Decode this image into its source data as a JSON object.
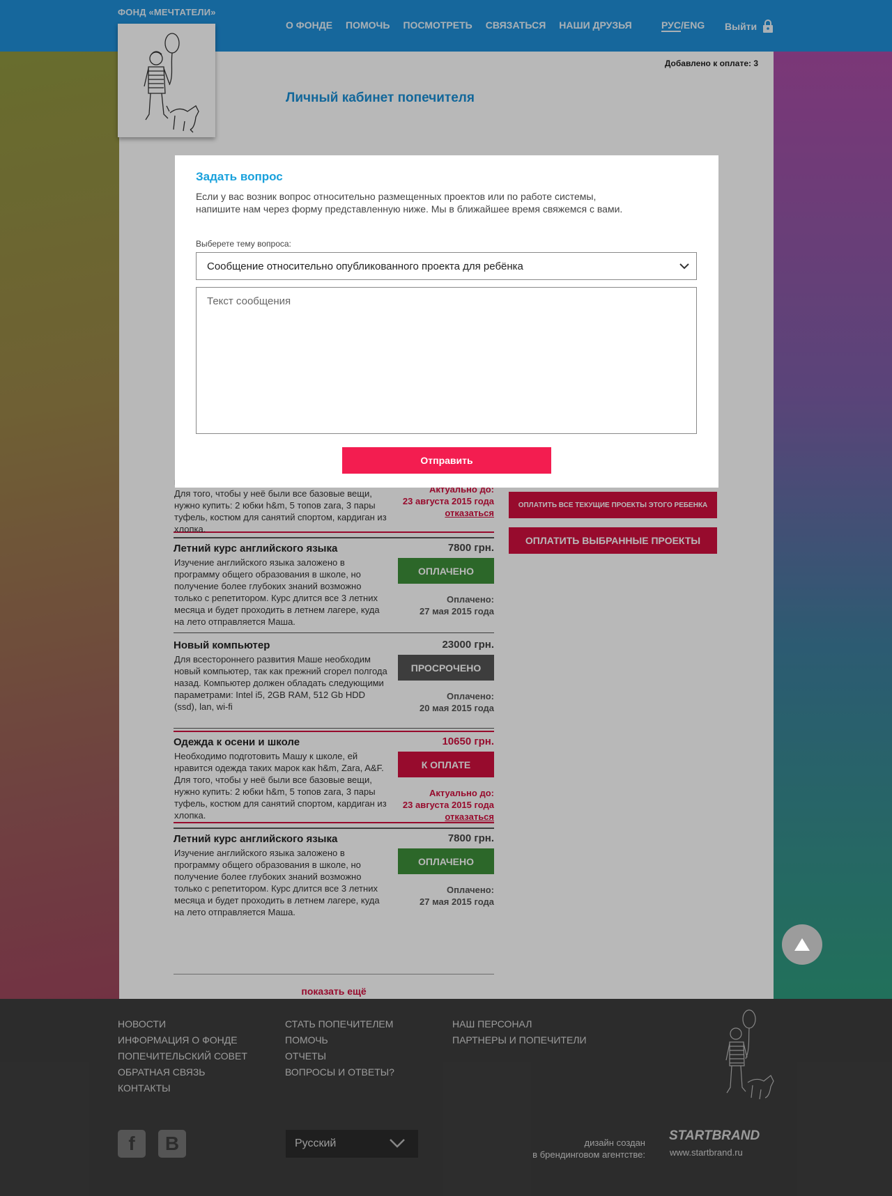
{
  "header": {
    "brand": "ФОНД «МЕЧТАТЕЛИ»",
    "nav": [
      "О ФОНДЕ",
      "ПОМОЧЬ",
      "ПОСМОТРЕТЬ",
      "СВЯЗАТЬСЯ",
      "НАШИ ДРУЗЬЯ"
    ],
    "lang_ru": "РУС",
    "lang_sep": "/",
    "lang_en": "ENG",
    "logout": "Выйти",
    "logout_icon": "lock-icon"
  },
  "main": {
    "added": "Добавлено к оплате: 3",
    "title": "Личный кабинет попечителя",
    "projects": [
      {
        "title": "",
        "amount": "",
        "desc": "нравится одежда таких марок как h&m, Zara, A&F. Для того, чтобы у неё были все базовые вещи, нужно купить: 2 юбки h&m, 5 топов zara, 3 пары туфель, костюм для санятий спортом, кардиган из хлопка.",
        "button": "",
        "meta1": "Актуально до:",
        "meta2": "23 августа 2015 года",
        "meta3": "отказаться"
      },
      {
        "title": "Летний курс английского языка",
        "amount": "7800 грн.",
        "desc": "Изучение английского языка заложено в программу общего образования в школе, но получение более глубоких знаний возможно только с репетитором. Курс длится все 3 летних месяца и будет проходить в летнем лагере, куда на лето отправляется Маша.",
        "button": "ОПЛАЧЕНО",
        "meta1": "Оплачено:",
        "meta2": "27 мая 2015 года"
      },
      {
        "title": "Новый компьютер",
        "amount": "23000 грн.",
        "desc": "Для всестороннего развития Маше необходим новый компьютер, так как прежний сгорел полгода назад. Компьютер должен обладать следующими параметрами: Intel i5, 2GB RAM, 512 Gb HDD (ssd), lan, wi-fi",
        "button": "ПРОСРОЧЕНО",
        "meta1": "Оплачено:",
        "meta2": "20 мая 2015 года"
      },
      {
        "title": "Одежда к осени и школе",
        "amount": "10650 грн.",
        "desc": "Необходимо подготовить Машу к школе, ей нравится одежда таких марок как h&m, Zara, A&F. Для того, чтобы у неё были все базовые вещи, нужно купить: 2 юбки h&m, 5 топов zara, 3 пары туфель, костюм для санятий спортом, кардиган из хлопка.",
        "button": "К ОПЛАТЕ",
        "meta1": "Актуально до:",
        "meta2": "23 августа 2015 года",
        "meta3": "отказаться"
      },
      {
        "title": "Летний курс английского языка",
        "amount": "7800 грн.",
        "desc": "Изучение английского языка заложено в программу общего образования в школе, но получение более глубоких знаний возможно только с репетитором. Курс длится все 3 летних месяца и будет проходить в летнем лагере, куда на лето отправляется Маша.",
        "button": "ОПЛАЧЕНО",
        "meta1": "Оплачено:",
        "meta2": "27 мая 2015 года"
      }
    ],
    "show_more": "показать ещё",
    "pay_all_child": "ОПЛАТИТЬ ВСЕ ТЕКУЩИЕ ПРОЕКТЫ ЭТОГО РЕБЕНКА",
    "pay_selected": "ОПЛАТИТЬ ВЫБРАННЫЕ ПРОЕКТЫ"
  },
  "modal": {
    "title": "Задать вопрос",
    "text": "Если у вас возник вопрос относительно размещенных проектов или по работе системы, напишите нам через форму представленную ниже. Мы в ближайшее время свяжемся с вами.",
    "topic_label": "Выберете тему вопроса:",
    "topic_value": "Сообщение относительно опубликованного проекта для ребёнка",
    "message_placeholder": "Текст сообщения",
    "send": "Отправить"
  },
  "footer": {
    "col1": [
      "НОВОСТИ",
      "ИНФОРМАЦИЯ О ФОНДЕ",
      "ПОПЕЧИТЕЛЬСКИЙ СОВЕТ",
      "ОБРАТНАЯ СВЯЗЬ",
      "КОНТАКТЫ"
    ],
    "col2": [
      "СТАТЬ ПОПЕЧИТЕЛЕМ",
      "ПОМОЧЬ",
      "ОТЧЕТЫ",
      "ВОПРОСЫ И ОТВЕТЫ?"
    ],
    "col3": [
      "НАШ ПЕРСОНАЛ",
      "ПАРТНЕРЫ И ПОПЕЧИТЕЛИ"
    ],
    "social": [
      {
        "icon": "facebook-icon",
        "glyph": "f"
      },
      {
        "icon": "vk-icon",
        "glyph": "B"
      }
    ],
    "language": "Русский",
    "credit_line1": "дизайн создан",
    "credit_line2": "в брендинговом агентстве:",
    "agency": "STARTBRAND",
    "agency_url": "www.startbrand.ru"
  },
  "colors": {
    "header": "#1f8fd8",
    "accent_red": "#d2103f",
    "send_button": "#f31d50",
    "paid_green": "#3d8f3a",
    "overdue_gray": "#555555",
    "modal_title": "#19a1dc",
    "footer": "#3e3e3e"
  }
}
